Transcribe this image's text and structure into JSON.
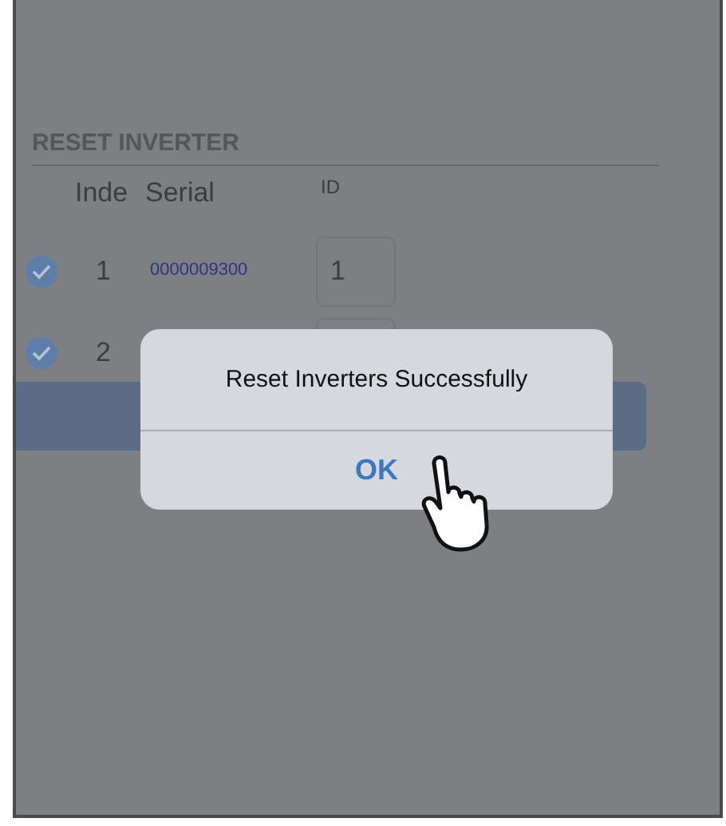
{
  "section": {
    "title": "RESET INVERTER"
  },
  "table": {
    "columns": [
      "Inde",
      "Serial",
      "ID"
    ],
    "rows": [
      {
        "checked": true,
        "index": "1",
        "serial": "0000009300",
        "id": "1"
      },
      {
        "checked": true,
        "index": "2"
      }
    ]
  },
  "dialog": {
    "message": "Reset Inverters Successfully",
    "button": "OK"
  }
}
